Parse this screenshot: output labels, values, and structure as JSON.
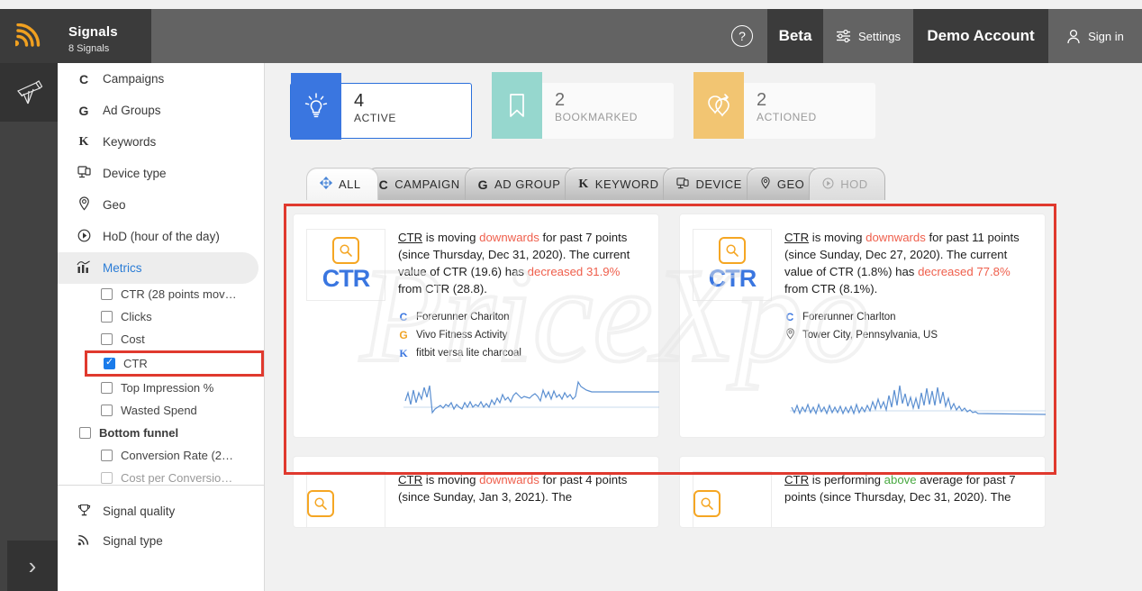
{
  "header": {
    "rss_icon": "rss-icon",
    "app_title": "Signals",
    "app_subtitle": "8 Signals",
    "help_label": "?",
    "beta_label": "Beta",
    "settings_label": "Settings",
    "account_label": "Demo Account",
    "signin_label": "Sign in"
  },
  "rail": {
    "telescope_icon": "telescope-icon",
    "expand_label": "›"
  },
  "sidebar": {
    "items": [
      {
        "label": "Campaigns",
        "icon": "letter-c-icon",
        "selected": false
      },
      {
        "label": "Ad Groups",
        "icon": "letter-g-icon",
        "selected": false
      },
      {
        "label": "Keywords",
        "icon": "letter-k-icon",
        "selected": false
      },
      {
        "label": "Device type",
        "icon": "device-icon",
        "selected": false
      },
      {
        "label": "Geo",
        "icon": "location-pin-icon",
        "selected": false
      },
      {
        "label": "HoD (hour of the day)",
        "icon": "clock-icon",
        "selected": false
      },
      {
        "label": "Metrics",
        "icon": "bar-chart-icon",
        "selected": true
      }
    ],
    "metrics": [
      {
        "label": "CTR (28 points mov…",
        "checked": false,
        "group": false,
        "highlight": false
      },
      {
        "label": "Clicks",
        "checked": false,
        "group": false,
        "highlight": false
      },
      {
        "label": "Cost",
        "checked": false,
        "group": false,
        "highlight": false
      },
      {
        "label": "CTR",
        "checked": true,
        "group": false,
        "highlight": true
      },
      {
        "label": "Top Impression %",
        "checked": false,
        "group": false,
        "highlight": false
      },
      {
        "label": "Wasted Spend",
        "checked": false,
        "group": false,
        "highlight": false
      },
      {
        "label": "Bottom funnel",
        "checked": false,
        "group": true,
        "highlight": false
      },
      {
        "label": "Conversion Rate (2…",
        "checked": false,
        "group": false,
        "highlight": false
      },
      {
        "label": "Cost per Conversio…",
        "checked": false,
        "group": false,
        "highlight": false
      }
    ],
    "bottom_items": [
      {
        "label": "Signal quality",
        "icon": "trophy-icon"
      },
      {
        "label": "Signal type",
        "icon": "rss-icon"
      }
    ]
  },
  "stats": [
    {
      "count": "4",
      "label": "Active",
      "icon": "lightbulb-icon",
      "color": "#3a76e0",
      "selected": true
    },
    {
      "count": "2",
      "label": "Bookmarked",
      "icon": "bookmark-icon",
      "color": "#96d7ce",
      "selected": false
    },
    {
      "count": "2",
      "label": "Actioned",
      "icon": "linked-loops-icon",
      "color": "#f2c572",
      "selected": false
    }
  ],
  "tabs": [
    {
      "label": "All",
      "icon": "move-arrows-icon",
      "active": true,
      "disabled": false
    },
    {
      "label": "Campaign",
      "icon": "letter-c-icon",
      "active": false,
      "disabled": false
    },
    {
      "label": "Ad Group",
      "icon": "letter-g-icon",
      "active": false,
      "disabled": false
    },
    {
      "label": "Keyword",
      "icon": "letter-k-icon",
      "active": false,
      "disabled": false
    },
    {
      "label": "Device",
      "icon": "device-icon",
      "active": false,
      "disabled": false
    },
    {
      "label": "Geo",
      "icon": "location-pin-icon",
      "active": false,
      "disabled": false
    },
    {
      "label": "HoD",
      "icon": "clock-icon",
      "active": false,
      "disabled": true
    }
  ],
  "signals": [
    {
      "metric": "CTR",
      "badge_icon": "magnifier-icon",
      "text": {
        "p1": " is moving ",
        "direction": "downwards",
        "direction_tone": "down",
        "p2": " for past 7 points (since Thursday, Dec 31, 2020). The current value of CTR (19.6) has ",
        "change_word": "decreased",
        "change_pct": "31.9%",
        "p3": " from CTR (28.8)."
      },
      "entities": [
        {
          "icon": "letter-c-icon",
          "kind": "campaign",
          "label": "Forerunner Charlton"
        },
        {
          "icon": "letter-g-icon",
          "kind": "adgroup",
          "label": "Vivo Fitness Activity"
        },
        {
          "icon": "letter-k-icon",
          "kind": "keyword",
          "label": "fitbit versa lite charcoal"
        }
      ]
    },
    {
      "metric": "CTR",
      "badge_icon": "magnifier-icon",
      "text": {
        "p1": " is moving ",
        "direction": "downwards",
        "direction_tone": "down",
        "p2": " for past 11 points (since Sunday, Dec 27, 2020). The current value of CTR (1.8%) has ",
        "change_word": "decreased",
        "change_pct": "77.8%",
        "p3": " from CTR (8.1%)."
      },
      "entities": [
        {
          "icon": "letter-c-icon",
          "kind": "campaign",
          "label": "Forerunner Charlton"
        },
        {
          "icon": "location-pin-icon",
          "kind": "geo",
          "label": "Tower City, Pennsylvania, US"
        }
      ]
    }
  ],
  "signals_partial": [
    {
      "metric": "CTR",
      "badge_icon": "magnifier-icon",
      "text": {
        "p1": " is moving ",
        "direction": "downwards",
        "direction_tone": "down",
        "p2": " for past 4 points (since Sunday, Jan 3, 2021). The"
      }
    },
    {
      "metric": "CTR",
      "badge_icon": "magnifier-icon",
      "text": {
        "p1": " is performing ",
        "direction": "above",
        "direction_tone": "up",
        "p2": " average for past 7 points (since Thursday, Dec 31, 2020). The"
      }
    }
  ],
  "watermark": {
    "text": "PriceXpo"
  },
  "colors": {
    "accent_blue": "#3a76e0",
    "down_red": "#ef5f4c",
    "up_green": "#49a942",
    "highlight_red": "#e0392e",
    "amber": "#f5a623",
    "header_dark": "#3b3b3b",
    "header_grey": "#636363"
  },
  "chart_data": [
    {
      "type": "line",
      "title": "CTR sparkline - signal 1",
      "values": [
        52,
        30,
        60,
        26,
        62,
        30,
        55,
        22,
        40,
        18,
        8,
        14,
        18,
        20,
        16,
        22,
        18,
        26,
        14,
        22,
        18,
        14,
        24,
        16,
        26,
        16,
        20,
        18,
        26,
        16,
        22,
        16,
        30,
        22,
        34,
        26,
        44,
        34,
        40,
        30,
        46,
        50,
        46,
        42,
        44,
        44,
        42,
        46,
        52,
        46,
        38,
        60,
        44,
        56,
        40,
        58,
        44,
        50,
        42,
        54,
        44,
        50,
        40,
        46,
        86,
        78,
        74,
        70,
        68,
        66
      ],
      "ylim": [
        0,
        100
      ],
      "grid": false
    },
    {
      "type": "line",
      "title": "CTR sparkline - signal 2",
      "values": [
        30,
        16,
        34,
        14,
        30,
        18,
        36,
        16,
        30,
        14,
        36,
        18,
        30,
        14,
        34,
        16,
        30,
        16,
        32,
        14,
        30,
        16,
        32,
        14,
        36,
        16,
        30,
        18,
        34,
        20,
        40,
        26,
        46,
        28,
        40,
        24,
        52,
        30,
        62,
        36,
        70,
        40,
        56,
        34,
        48,
        30,
        46,
        28,
        58,
        34,
        66,
        38,
        60,
        36,
        68,
        40,
        58,
        34,
        50,
        30,
        38,
        26,
        30,
        24,
        26,
        22,
        22,
        20,
        18,
        16
      ],
      "ylim": [
        0,
        100
      ],
      "grid": false
    }
  ]
}
